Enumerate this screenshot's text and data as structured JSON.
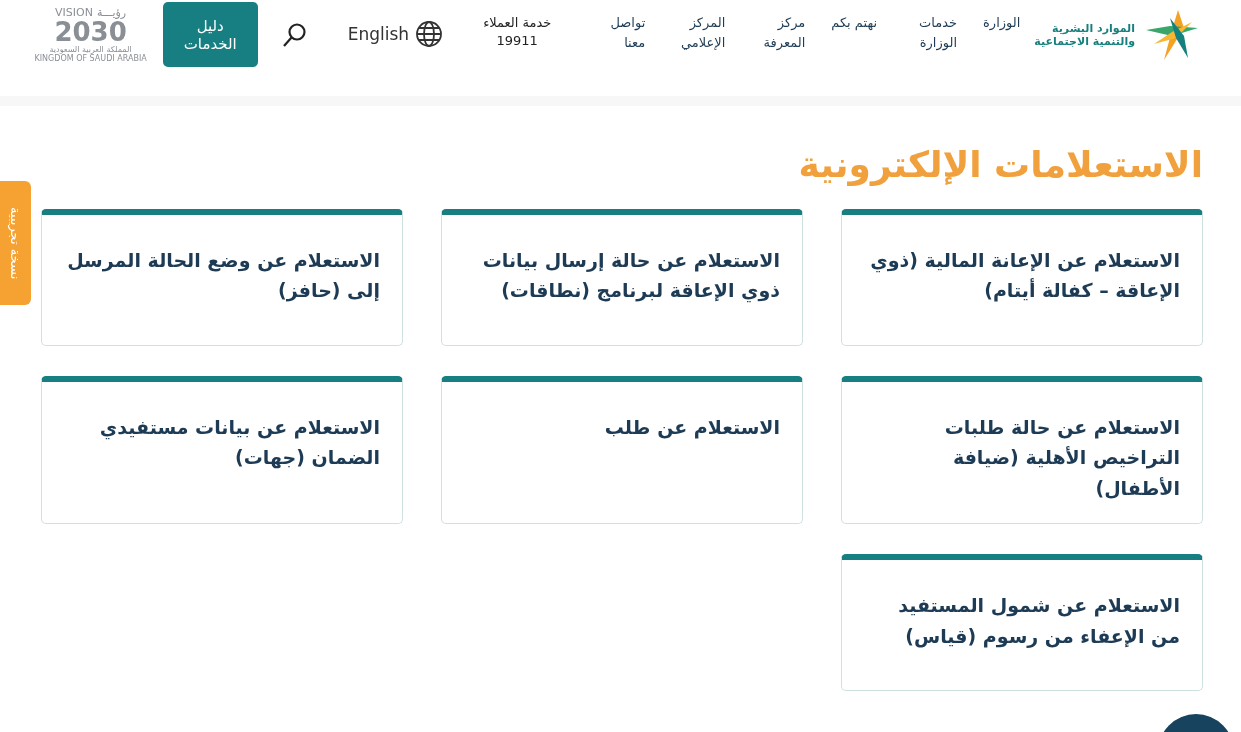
{
  "header": {
    "logo": {
      "line_1": "الموارد البشرية",
      "line_2": "والتنمية الاجتماعية"
    },
    "nav": [
      {
        "label": "الوزارة"
      },
      {
        "label": "خدمات الوزارة"
      },
      {
        "label": "نهتم بكم"
      },
      {
        "label": "مركز المعرفة"
      },
      {
        "label": "المركز الإعلامي"
      },
      {
        "label": "تواصل معنا"
      }
    ],
    "customer_service": {
      "label": "خدمة العملاء",
      "number": "19911"
    },
    "language": "English",
    "services_button": "دليل الخدمات",
    "vision": {
      "title": "VISION",
      "title_ar": "رؤيـــة",
      "year": "2030",
      "country_ar": "المملكة العربية السعودية",
      "country_en": "KINGDOM OF SAUDI ARABIA"
    }
  },
  "side_tab": "نسخة تجريبية",
  "title": "الاستعلامات الإلكترونية",
  "cards": [
    {
      "text": "الاستعلام عن الإعانة المالية (ذوي الإعاقة – كفالة أيتام)"
    },
    {
      "text": "الاستعلام عن حالة إرسال بيانات ذوي الإعاقة لبرنامج (نطاقات)"
    },
    {
      "text": "الاستعلام عن وضع الحالة المرسل إلى (حافز)"
    },
    {
      "text": "الاستعلام عن حالة طلبات التراخيص الأهلية (ضيافة الأطفال)"
    },
    {
      "text": "الاستعلام عن طلب"
    },
    {
      "text": "الاستعلام عن بيانات مستفيدي الضمان (جهات)"
    },
    {
      "text": "الاستعلام عن شمول المستفيد من الإعفاء من رسوم (قياس)"
    }
  ]
}
